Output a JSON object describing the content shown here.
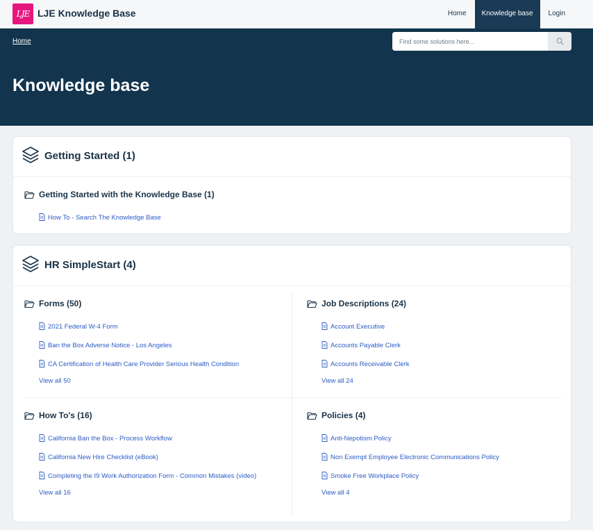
{
  "header": {
    "logo_text": "LJE",
    "site_title": "LJE Knowledge Base",
    "nav": [
      {
        "label": "Home"
      },
      {
        "label": "Knowledge base"
      },
      {
        "label": "Login"
      }
    ]
  },
  "hero": {
    "breadcrumb": "Home",
    "search_placeholder": "Find some solutions here...",
    "title": "Knowledge base"
  },
  "categories": [
    {
      "title": "Getting Started (1)",
      "folders": [
        {
          "title": "Getting Started with the Knowledge Base (1)",
          "articles": [
            "How To - Search The Knowledge Base"
          ]
        }
      ]
    },
    {
      "title": "HR SimpleStart (4)",
      "folders": [
        {
          "title": "Forms (50)",
          "articles": [
            "2021 Federal W-4 Form",
            "Ban the Box Adverse Notice - Los Angeles",
            "CA Certification of Health Care Provider Serious Health Condition"
          ],
          "view_all": "View all 50"
        },
        {
          "title": "Job Descriptions (24)",
          "articles": [
            "Account Executive",
            "Accounts Payable Clerk",
            "Accounts Receivable Clerk"
          ],
          "view_all": "View all 24"
        },
        {
          "title": "How To's (16)",
          "articles": [
            "California Ban the Box - Process Workflow",
            "California New Hire Checklist (eBook)",
            "Completing the I9 Work Authorization Form - Common Mistakes (video)"
          ],
          "view_all": "View all 16"
        },
        {
          "title": "Policies (4)",
          "articles": [
            "Anti-Nepotism Policy",
            "Non Exempt Employee Electronic Communications Policy",
            "Smoke Free Workplace Policy"
          ],
          "view_all": "View all 4"
        }
      ]
    }
  ],
  "colors": {
    "hero_bg": "#12344d",
    "link": "#2c5cc5",
    "logo_bg": "#e6167e",
    "active_nav": "#1a3a55"
  }
}
